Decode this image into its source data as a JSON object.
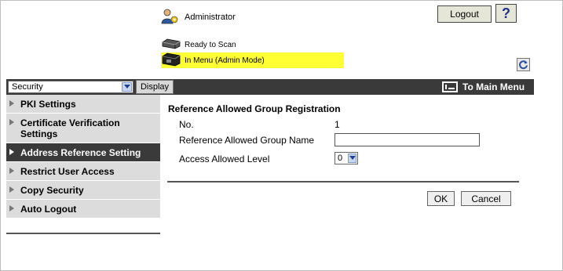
{
  "header": {
    "user_label": "Administrator",
    "logout_label": "Logout",
    "help_label": "?",
    "status_ready": "Ready to Scan",
    "status_mode": "In Menu (Admin Mode)"
  },
  "toolbar": {
    "category_selected": "Security",
    "display_label": "Display",
    "main_menu_label": "To Main Menu"
  },
  "sidebar": {
    "items": [
      {
        "label": "PKI Settings"
      },
      {
        "label": "Certificate Verification Settings"
      },
      {
        "label": "Address Reference Setting",
        "active": true
      },
      {
        "label": "Restrict User Access"
      },
      {
        "label": "Copy Security"
      },
      {
        "label": "Auto Logout"
      }
    ]
  },
  "form": {
    "title": "Reference Allowed Group Registration",
    "no_label": "No.",
    "no_value": "1",
    "group_name_label": "Reference Allowed Group Name",
    "group_name_value": "",
    "access_level_label": "Access Allowed Level",
    "access_level_value": "0",
    "ok_label": "OK",
    "cancel_label": "Cancel"
  },
  "colors": {
    "dark_bar": "#3a3a3a",
    "mode_highlight": "#ffff33",
    "nav_bg": "#dcdcdc"
  },
  "icons": [
    "admin-user-icon",
    "help-icon",
    "scanner-ready-icon",
    "printer-menu-icon",
    "refresh-icon",
    "dropdown-arrow-icon",
    "main-menu-icon",
    "nav-triangle-icon"
  ]
}
